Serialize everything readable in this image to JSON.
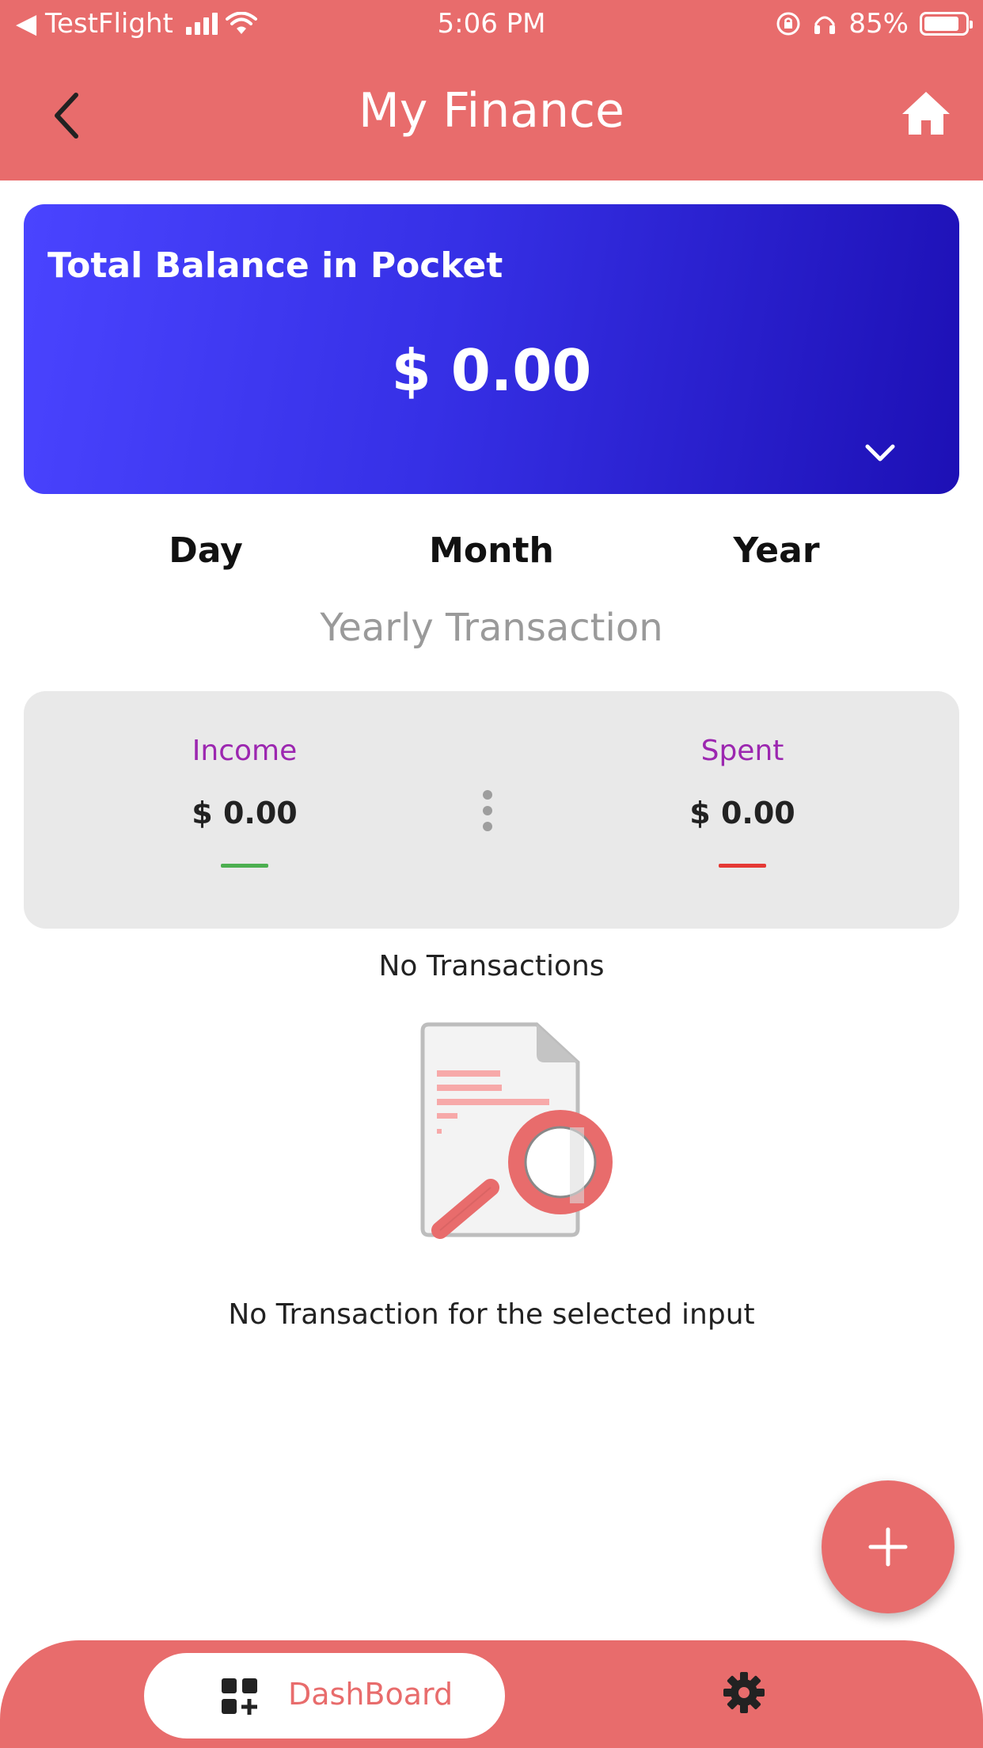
{
  "status_bar": {
    "back_app": "◀ TestFlight",
    "time": "5:06 PM",
    "battery": "85%",
    "battery_level": 0.85
  },
  "header": {
    "title": "My Finance",
    "back_icon": "chevron-left-icon",
    "home_icon": "home-icon"
  },
  "balance_card": {
    "title": "Total Balance in Pocket",
    "amount": "$ 0.00",
    "expand_icon": "chevron-down-icon"
  },
  "periods": [
    "Day",
    "Month",
    "Year"
  ],
  "subheading": "Yearly Transaction",
  "summary": {
    "income_label": "Income",
    "income_value": "$ 0.00",
    "spent_label": "Spent",
    "spent_value": "$ 0.00",
    "income_color": "#4CAF50",
    "spent_color": "#E53935"
  },
  "empty_state": {
    "heading": "No Transactions",
    "message": "No Transaction for the selected input",
    "illustration_icon": "document-search-icon"
  },
  "fab": {
    "icon": "plus-icon"
  },
  "bottom_nav": {
    "dashboard_label": "DashBoard",
    "dashboard_icon": "dashboard-add-icon",
    "settings_icon": "gear-icon"
  },
  "colors": {
    "primary": "#E86C6C",
    "card_gradient_start": "#4A44FF",
    "card_gradient_end": "#1D10B5",
    "label_purple": "#9C27B0"
  }
}
